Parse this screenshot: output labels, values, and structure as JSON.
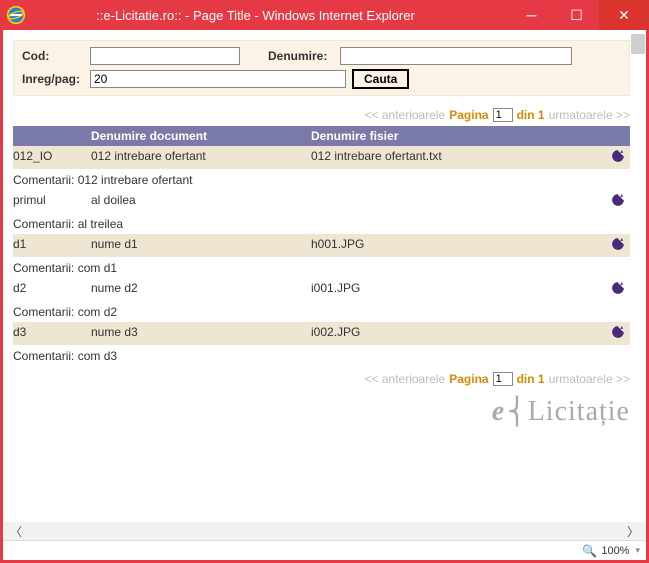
{
  "window": {
    "title": "::e-Licitatie.ro:: - Page Title - Windows Internet Explorer"
  },
  "filter": {
    "cod_label": "Cod:",
    "cod_value": "",
    "den_label": "Denumire:",
    "den_value": "",
    "perpage_label": "Inreg/pag:",
    "perpage_value": "20",
    "search_btn": "Cauta"
  },
  "pager": {
    "prev": "<< anterioarele",
    "page_word": "Pagina",
    "page_value": "1",
    "of_word": "din 1",
    "next": "urmatoarele >>"
  },
  "headers": {
    "doc": "Denumire document",
    "file": "Denumire fisier"
  },
  "rows": [
    {
      "id": "012_IO",
      "doc": "012 intrebare ofertant",
      "file": "012 intrebare ofertant.txt",
      "comment": "012 intrebare ofertant"
    },
    {
      "id": "primul",
      "doc": "al doilea",
      "file": "",
      "comment": "al treilea"
    },
    {
      "id": "d1",
      "doc": "nume d1",
      "file": "h001.JPG",
      "comment": "com d1"
    },
    {
      "id": "d2",
      "doc": "nume d2",
      "file": "i001.JPG",
      "comment": "com d2"
    },
    {
      "id": "d3",
      "doc": "nume d3",
      "file": "i002.JPG",
      "comment": "com d3"
    }
  ],
  "comment_label": "Comentarii:",
  "logo": {
    "text": "Licitație"
  },
  "status": {
    "zoom": "100%"
  }
}
